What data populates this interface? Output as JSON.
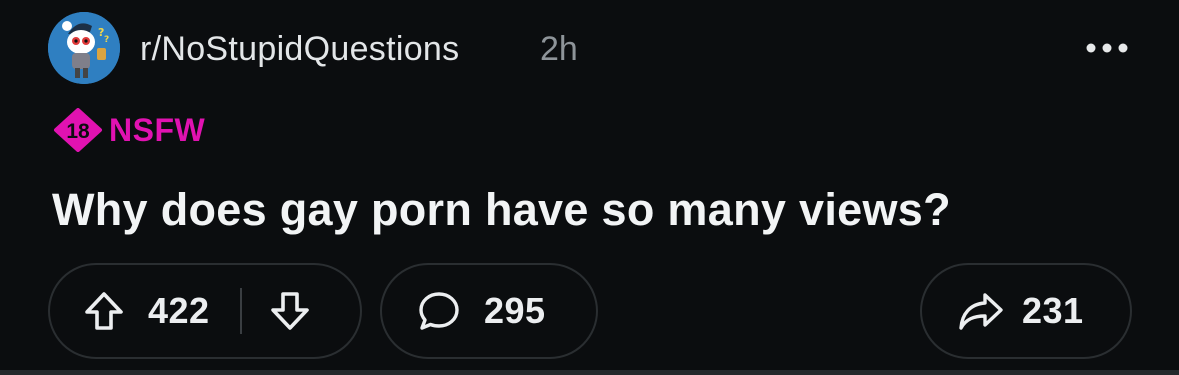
{
  "post": {
    "subreddit": "r/NoStupidQuestions",
    "age": "2h",
    "nsfw_badge_number": "18",
    "nsfw_label": "NSFW",
    "title": "Why does gay porn have so many views?",
    "upvotes": "422",
    "comments": "295",
    "shares": "231"
  },
  "icons": {
    "avatar": "subreddit-avatar-icon",
    "more": "more-options-icon",
    "upvote": "upvote-arrow-icon",
    "downvote": "downvote-arrow-icon",
    "comment": "comment-bubble-icon",
    "share": "share-arrow-icon"
  },
  "colors": {
    "background": "#0b0d0f",
    "nsfw_pink": "#e112b1",
    "avatar_blue": "#2f7fc1",
    "muted_text": "#8e9499",
    "pill_border": "#2a2e31"
  }
}
